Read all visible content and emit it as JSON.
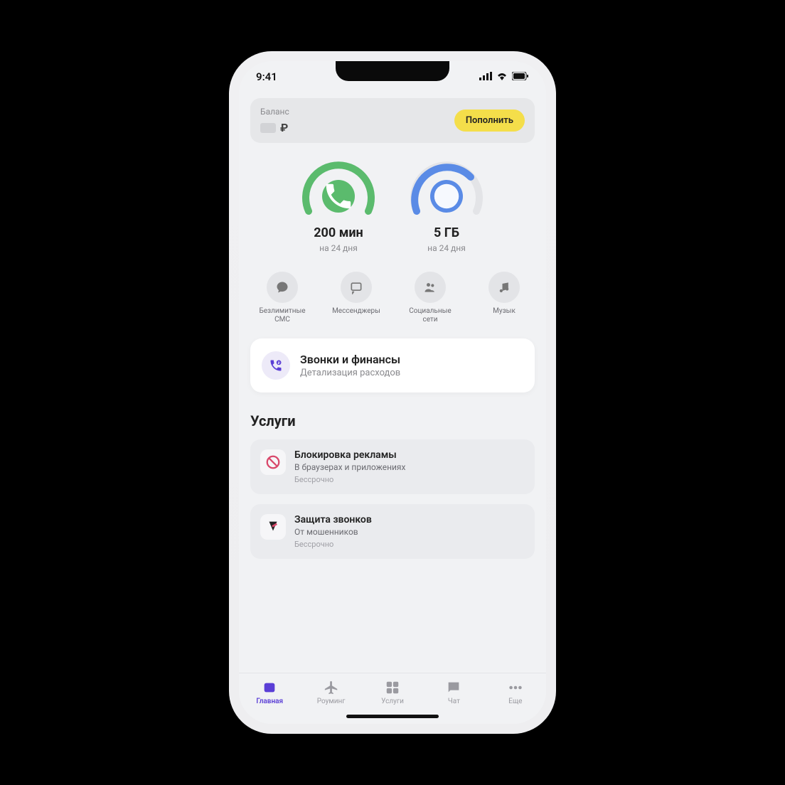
{
  "status": {
    "time": "9:41"
  },
  "balance": {
    "label": "Баланс",
    "currency": "₽",
    "topup": "Пополнить"
  },
  "gauges": [
    {
      "value": "200 мин",
      "sub": "на 24 дня",
      "color": "green",
      "icon": "phone"
    },
    {
      "value": "5 ГБ",
      "sub": "на 24 дня",
      "color": "blue",
      "icon": "globe"
    }
  ],
  "quick": [
    {
      "label": "Безлимитные СМС",
      "icon": "chat"
    },
    {
      "label": "Мессенджеры",
      "icon": "message"
    },
    {
      "label": "Социальные сети",
      "icon": "people"
    },
    {
      "label": "Музык",
      "icon": "music"
    }
  ],
  "finance_card": {
    "title": "Звонки и финансы",
    "sub": "Детализация расходов"
  },
  "services_title": "Услуги",
  "services": [
    {
      "title": "Блокировка рекламы",
      "sub": "В браузерах и приложениях",
      "meta": "Бессрочно",
      "icon": "block"
    },
    {
      "title": "Защита звонков",
      "sub": "От мошенников",
      "meta": "Бессрочно",
      "icon": "shield"
    }
  ],
  "tabs": [
    {
      "label": "Главная",
      "active": true
    },
    {
      "label": "Роуминг",
      "active": false
    },
    {
      "label": "Услуги",
      "active": false
    },
    {
      "label": "Чат",
      "active": false
    },
    {
      "label": "Еще",
      "active": false
    }
  ]
}
